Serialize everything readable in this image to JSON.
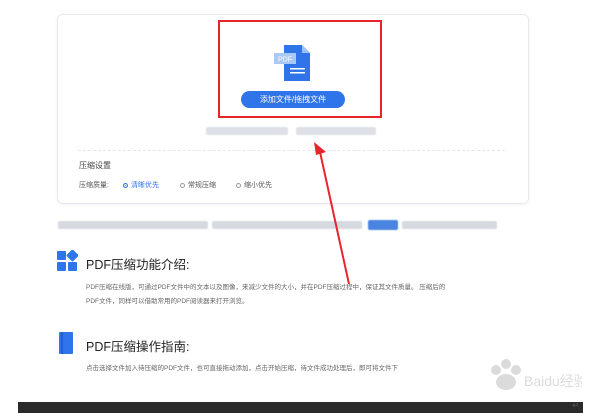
{
  "upload": {
    "icon_label": "PDF",
    "button_label": "添加文件/拖拽文件"
  },
  "settings": {
    "title": "压缩设置",
    "quality_label": "压缩质量:",
    "options": [
      "清晰优先",
      "常规压缩",
      "缩小优先"
    ],
    "selected": "清晰优先"
  },
  "sections": [
    {
      "title": "PDF压缩功能介绍:",
      "body_line1": "PDF压缩在线版，可通过PDF文件中的文本以及图像，来减少文件的大小，并在PDF压缩过程中，保证其文件质量。 压缩后的",
      "body_line2": "PDF文件，同样可以借助常用的PDF阅读器来打开浏览。"
    },
    {
      "title": "PDF压缩操作指南:",
      "body_line1": "点击选择文件加入待压缩的PDF文件，也可直接拖动添加，点击开始压缩，待文件成功处理后，即可将文件下"
    }
  ],
  "colors": {
    "accent": "#2f74e8",
    "highlight": "#e8252a",
    "icon_dark_blue": "#1d5fd6"
  },
  "footer": {
    "pilcrow": "↵"
  },
  "watermark_text": "Baidu经验"
}
